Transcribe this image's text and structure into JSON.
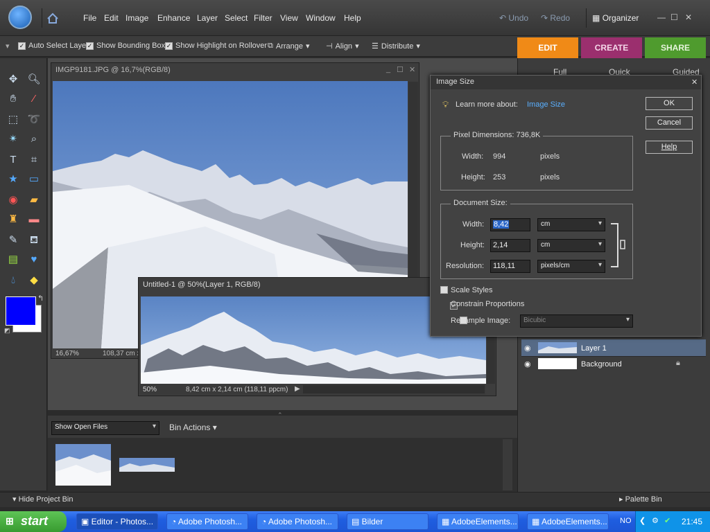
{
  "menubar": {
    "items": [
      "File",
      "Edit",
      "Image",
      "Enhance",
      "Layer",
      "Select",
      "Filter",
      "View",
      "Window",
      "Help"
    ],
    "undo": "Undo",
    "redo": "Redo",
    "organizer": "Organizer"
  },
  "options": {
    "auto_select": "Auto Select Layer",
    "bounding_box": "Show Bounding Box",
    "highlight": "Show Highlight on Rollover",
    "arrange": "Arrange",
    "align": "Align",
    "distribute": "Distribute"
  },
  "tabs": {
    "edit": "EDIT",
    "create": "CREATE",
    "share": "SHARE"
  },
  "palette_buttons": [
    "Full",
    "Quick",
    "Guided"
  ],
  "doc1": {
    "title": "IMGP9181.JPG @ 16,7%(RGB/8)",
    "zoom": "16,67%",
    "size": "108,37 cm x"
  },
  "doc2": {
    "title": "Untitled-1 @ 50%(Layer 1, RGB/8)",
    "zoom": "50%",
    "size": "8,42 cm x 2,14 cm (118,11 ppcm)"
  },
  "bin": {
    "show": "Show Open Files",
    "actions": "Bin Actions",
    "hide": "Hide Project Bin",
    "palette": "Palette Bin"
  },
  "layers": [
    "Layer 1",
    "Background"
  ],
  "dialog": {
    "title": "Image Size",
    "learn_prefix": "Learn more about:",
    "learn_link": "Image Size",
    "ok": "OK",
    "cancel": "Cancel",
    "help": "Help",
    "pixel_dim_label": "Pixel Dimensions: 736,8K",
    "px_width_label": "Width:",
    "px_width": "994",
    "px_width_unit": "pixels",
    "px_height_label": "Height:",
    "px_height": "253",
    "px_height_unit": "pixels",
    "doc_size_label": "Document Size:",
    "doc_width_label": "Width:",
    "doc_width": "8,42",
    "doc_width_unit": "cm",
    "doc_height_label": "Height:",
    "doc_height": "2,14",
    "doc_height_unit": "cm",
    "res_label": "Resolution:",
    "res": "118,11",
    "res_unit": "pixels/cm",
    "scale_styles": "Scale Styles",
    "constrain": "Constrain Proportions",
    "resample": "Resample Image:",
    "resample_method": "Bicubic"
  },
  "taskbar": {
    "start": "start",
    "tasks": [
      "Editor - Photos...",
      "Adobe Photosh...",
      "Adobe Photosh...",
      "Bilder",
      "AdobeElements...",
      "AdobeElements..."
    ],
    "lang": "NO",
    "time": "21:45"
  },
  "colors": {
    "edit_tab": "#f08a17",
    "create_tab": "#9b2f6e",
    "share_tab": "#4f9b2e",
    "foreground": "#0000ff",
    "link": "#5ab0ff"
  }
}
